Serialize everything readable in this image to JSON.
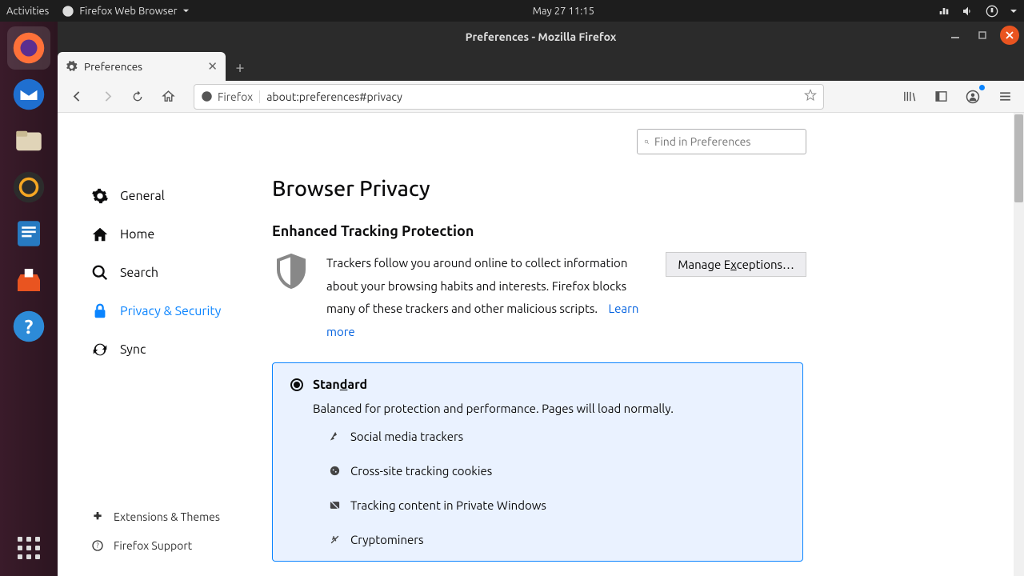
{
  "gnome": {
    "activities": "Activities",
    "app_menu": "Firefox Web Browser",
    "datetime": "May 27  11:15"
  },
  "window": {
    "title": "Preferences - Mozilla Firefox"
  },
  "tab": {
    "label": "Preferences"
  },
  "urlbar": {
    "identity": "Firefox",
    "url": "about:preferences#privacy"
  },
  "search": {
    "placeholder": "Find in Preferences"
  },
  "nav": {
    "general": "General",
    "home": "Home",
    "search": "Search",
    "privacy": "Privacy & Security",
    "sync": "Sync",
    "extensions": "Extensions & Themes",
    "support": "Firefox Support"
  },
  "page": {
    "title": "Browser Privacy",
    "section": "Enhanced Tracking Protection",
    "desc": "Trackers follow you around online to collect information about your browsing habits and interests. Firefox blocks many of these trackers and other malicious scripts.",
    "learn": "Learn more",
    "exceptions_pre": "Manage E",
    "exceptions_ul": "x",
    "exceptions_post": "ceptions…"
  },
  "card": {
    "title_pre": "Stan",
    "title_ul": "d",
    "title_post": "ard",
    "sub": "Balanced for protection and performance. Pages will load normally.",
    "items": {
      "social": "Social media trackers",
      "cookies": "Cross-site tracking cookies",
      "content": "Tracking content in Private Windows",
      "crypto": "Cryptominers"
    }
  }
}
